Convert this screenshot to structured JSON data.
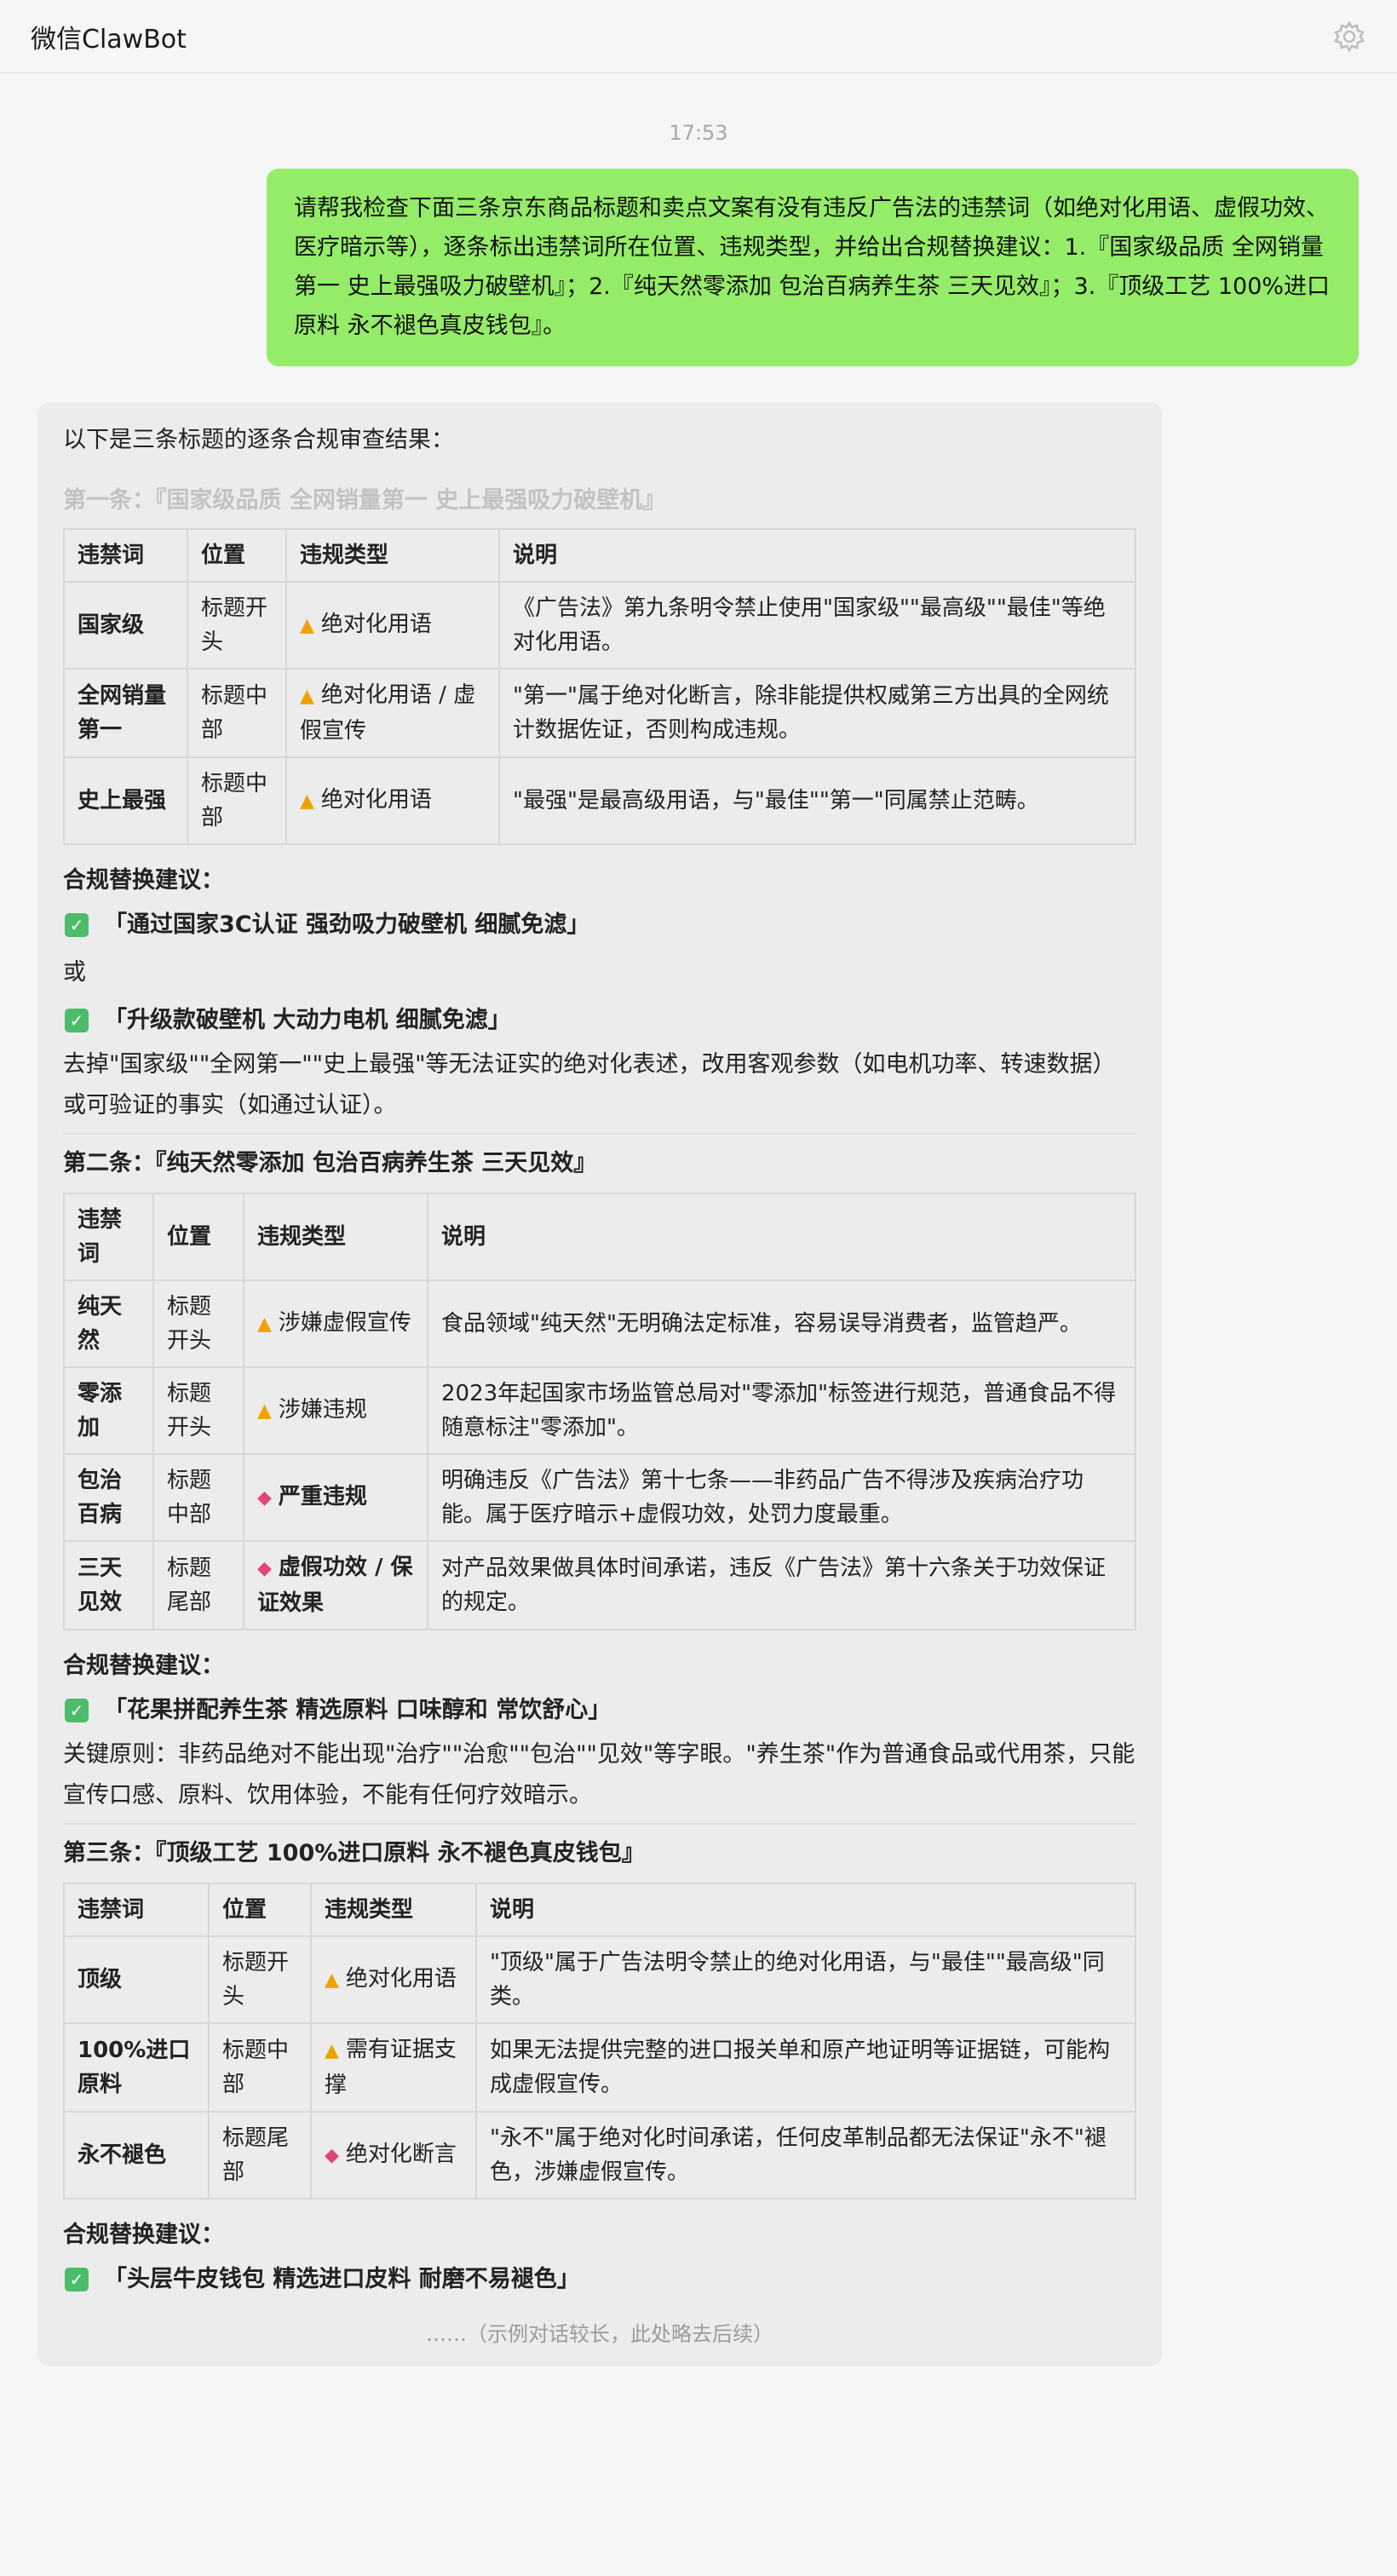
{
  "app": {
    "title": "微信ClawBot",
    "settings_icon": "gear-icon"
  },
  "chat": {
    "timestamp": "17:53",
    "user_message": "请帮我检查下面三条京东商品标题和卖点文案有没有违反广告法的违禁词（如绝对化用语、虚假功效、医疗暗示等），逐条标出违禁词所在位置、违规类型，并给出合规替换建议：1.『国家级品质 全网销量第一 史上最强吸力破壁机』；2.『纯天然零添加 包治百病养生茶 三天见效』；3.『顶级工艺 100%进口原料 永不褪色真皮钱包』。",
    "bot": {
      "intro": "以下是三条标题的逐条合规审查结果：",
      "headers": [
        "违禁词",
        "位置",
        "违规类型",
        "说明"
      ],
      "suggest_heading": "合规替换建议：",
      "or_text": "或",
      "truncated_note": "……（示例对话较长，此处略去后续）",
      "item1": {
        "title": "第一条：『国家级品质 全网销量第一 史上最强吸力破壁机』",
        "rows": [
          {
            "word": "国家级",
            "pos": "标题开头",
            "type": "绝对化用语",
            "icon": "warning-icon",
            "desc": "《广告法》第九条明令禁止使用\"国家级\"\"最高级\"\"最佳\"等绝对化用语。"
          },
          {
            "word": "全网销量第一",
            "pos": "标题中部",
            "type": "绝对化用语 / 虚假宣传",
            "icon": "warning-icon",
            "desc": "\"第一\"属于绝对化断言，除非能提供权威第三方出具的全网统计数据佐证，否则构成违规。"
          },
          {
            "word": "史上最强",
            "pos": "标题中部",
            "type": "绝对化用语",
            "icon": "warning-icon",
            "desc": "\"最强\"是最高级用语，与\"最佳\"\"第一\"同属禁止范畴。"
          }
        ],
        "suggest_a": "「通过国家3C认证 强劲吸力破壁机 细腻免滤」",
        "suggest_b": "「升级款破壁机 大动力电机 细腻免滤」",
        "note": "去掉\"国家级\"\"全网第一\"\"史上最强\"等无法证实的绝对化表述，改用客观参数（如电机功率、转速数据）或可验证的事实（如通过认证）。"
      },
      "item2": {
        "title": "第二条：『纯天然零添加 包治百病养生茶 三天见效』",
        "rows": [
          {
            "word": "纯天然",
            "pos": "标题开头",
            "type": "涉嫌虚假宣传",
            "icon": "warning-icon",
            "desc": "食品领域\"纯天然\"无明确法定标准，容易误导消费者，监管趋严。"
          },
          {
            "word": "零添加",
            "pos": "标题开头",
            "type": "涉嫌违规",
            "icon": "warning-icon",
            "desc": "2023年起国家市场监管总局对\"零添加\"标签进行规范，普通食品不得随意标注\"零添加\"。"
          },
          {
            "word": "包治百病",
            "pos": "标题中部",
            "type": "严重违规",
            "icon": "alarm-icon",
            "desc": "明确违反《广告法》第十七条——非药品广告不得涉及疾病治疗功能。属于医疗暗示+虚假功效，处罚力度最重。"
          },
          {
            "word": "三天见效",
            "pos": "标题尾部",
            "type": "虚假功效 / 保证效果",
            "icon": "alarm-icon",
            "desc": "对产品效果做具体时间承诺，违反《广告法》第十六条关于功效保证的规定。"
          }
        ],
        "suggest_a": "「花果拼配养生茶 精选原料 口味醇和 常饮舒心」",
        "note": "关键原则：非药品绝对不能出现\"治疗\"\"治愈\"\"包治\"\"见效\"等字眼。\"养生茶\"作为普通食品或代用茶，只能宣传口感、原料、饮用体验，不能有任何疗效暗示。"
      },
      "item3": {
        "title": "第三条：『顶级工艺 100%进口原料 永不褪色真皮钱包』",
        "rows": [
          {
            "word": "顶级",
            "pos": "标题开头",
            "type": "绝对化用语",
            "icon": "warning-icon",
            "desc": "\"顶级\"属于广告法明令禁止的绝对化用语，与\"最佳\"\"最高级\"同类。"
          },
          {
            "word": "100%进口原料",
            "pos": "标题中部",
            "type": "需有证据支撑",
            "icon": "warning-icon",
            "desc": "如果无法提供完整的进口报关单和原产地证明等证据链，可能构成虚假宣传。"
          },
          {
            "word": "永不褪色",
            "pos": "标题尾部",
            "type": "绝对化断言",
            "icon": "alarm-icon",
            "desc": "\"永不\"属于绝对化时间承诺，任何皮革制品都无法保证\"永不\"褪色，涉嫌虚假宣传。"
          }
        ],
        "suggest_a": "「头层牛皮钱包 精选进口皮料 耐磨不易褪色」"
      }
    }
  }
}
